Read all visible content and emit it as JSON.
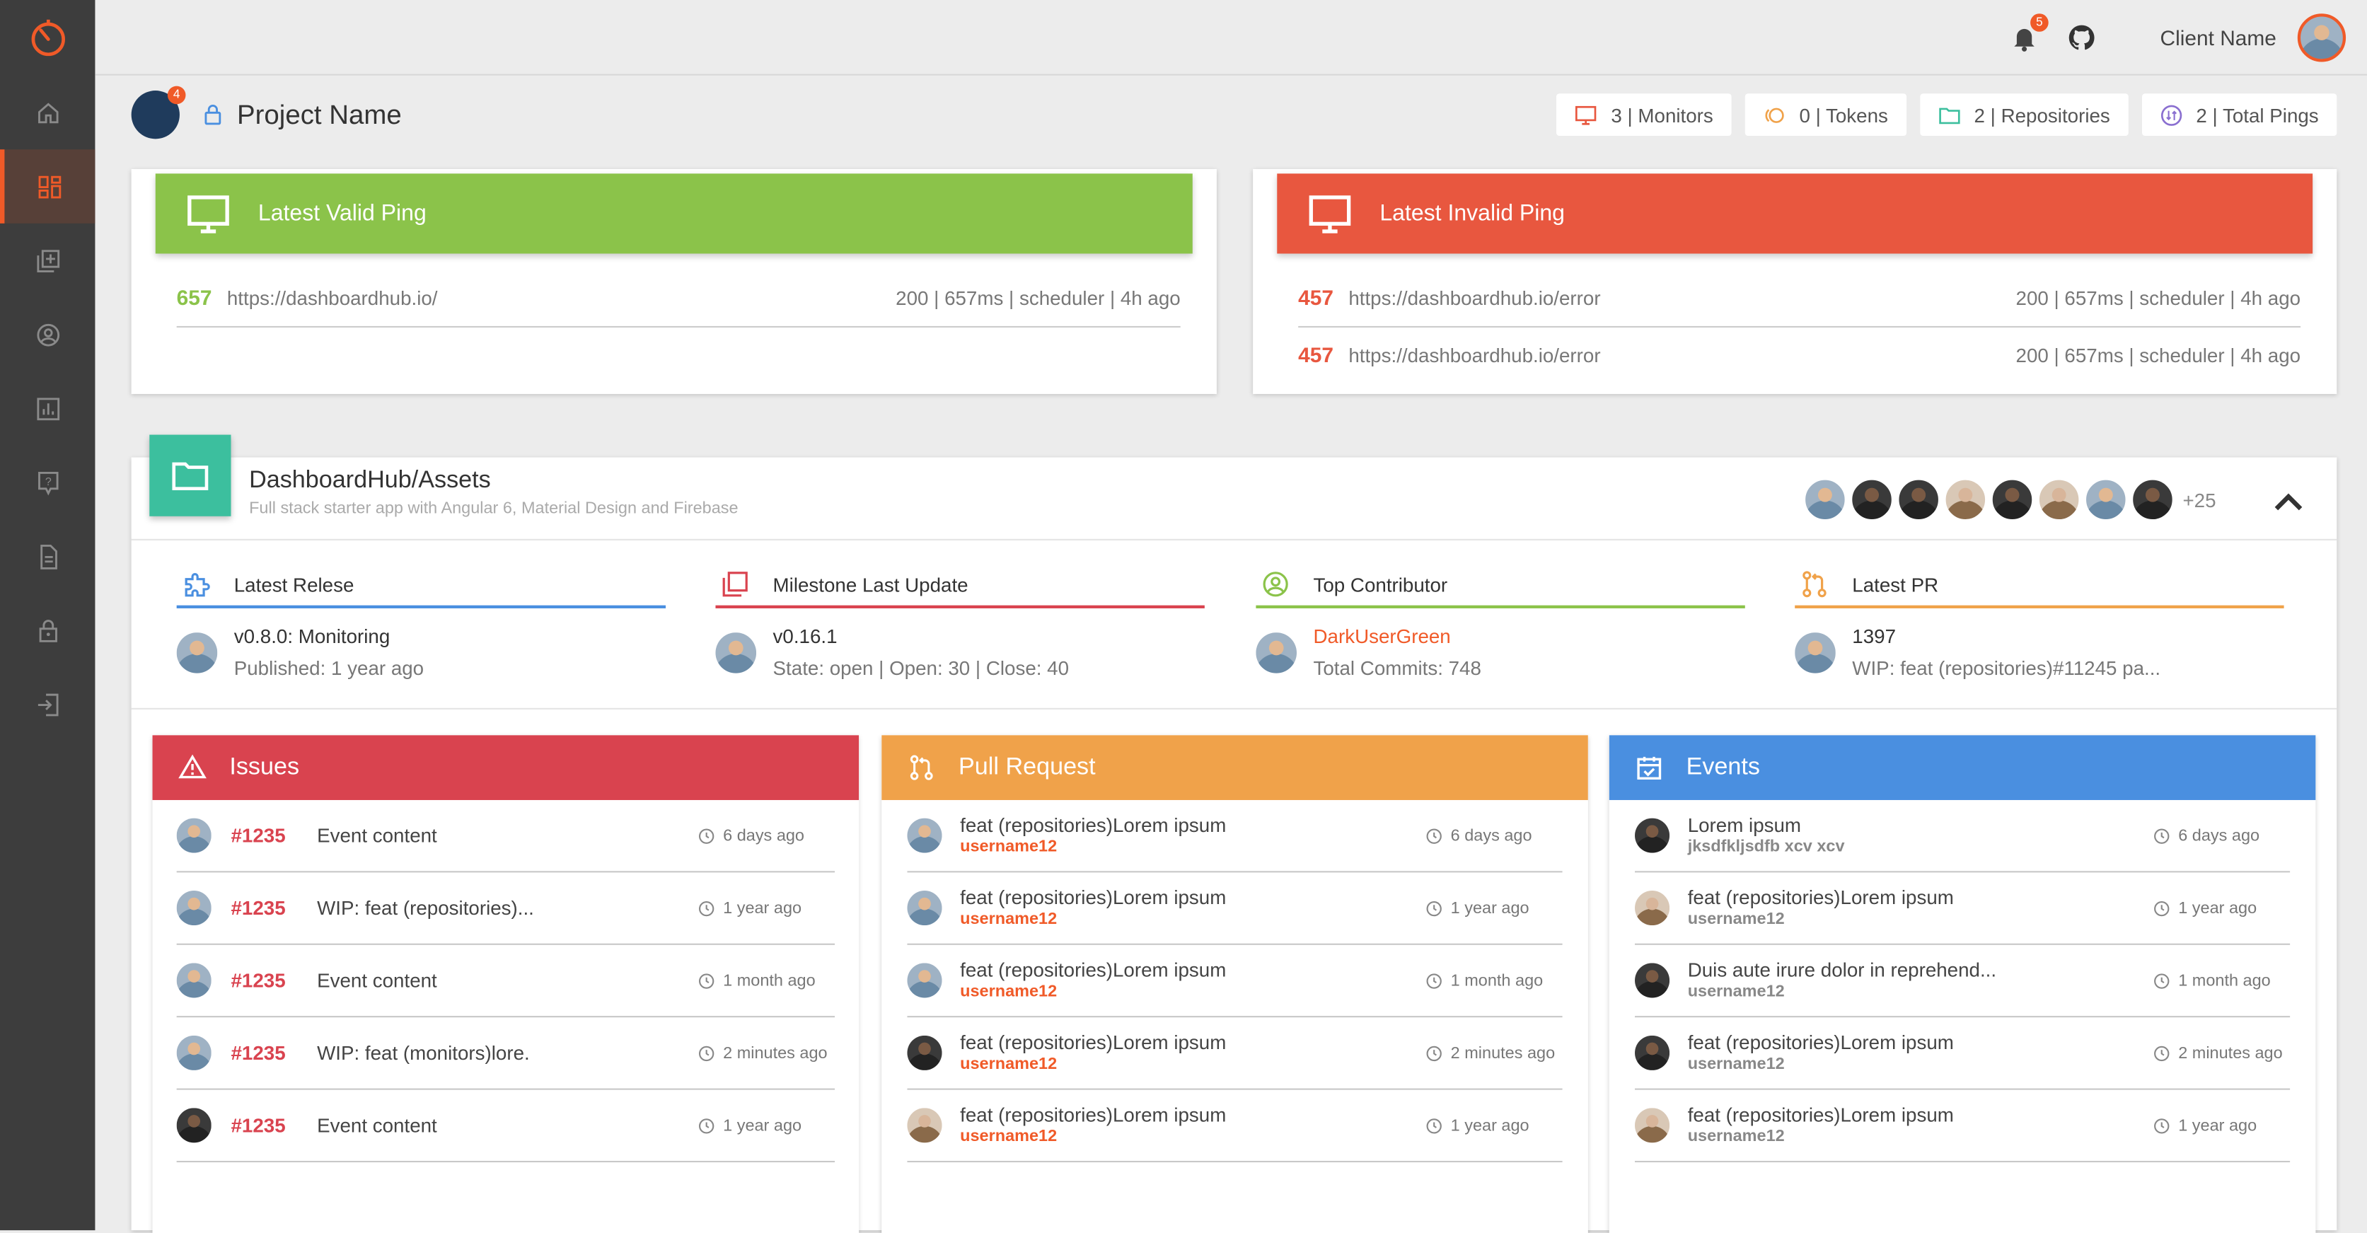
{
  "sidebar": {
    "items": [
      {
        "icon": "home-icon",
        "label": "Home"
      },
      {
        "icon": "dashboard-icon",
        "label": "Dashboard",
        "active": true
      },
      {
        "icon": "library-add-icon",
        "label": "Projects"
      },
      {
        "icon": "account-circle-icon",
        "label": "Account"
      },
      {
        "icon": "insert-chart-icon",
        "label": "Reports"
      },
      {
        "icon": "help-icon",
        "label": "Help"
      },
      {
        "icon": "description-icon",
        "label": "Docs"
      },
      {
        "icon": "lock-icon",
        "label": "Security"
      },
      {
        "icon": "exit-icon",
        "label": "Logout"
      }
    ]
  },
  "header": {
    "notifications_count": "5",
    "client_name": "Client Name"
  },
  "project": {
    "title": "Project Name",
    "badge": "4",
    "stats": {
      "monitors": "3 | Monitors",
      "tokens": "0 | Tokens",
      "repositories": "2 | Repositories",
      "pings": "2 | Total Pings"
    }
  },
  "valid_ping": {
    "title": "Latest Valid Ping",
    "rows": [
      {
        "code": "657",
        "url": "https://dashboardhub.io/",
        "meta": "200 | 657ms | scheduler | 4h ago"
      }
    ]
  },
  "invalid_ping": {
    "title": "Latest Invalid Ping",
    "rows": [
      {
        "code": "457",
        "url": "https://dashboardhub.io/error",
        "meta": "200 | 657ms | scheduler | 4h ago"
      },
      {
        "code": "457",
        "url": "https://dashboardhub.io/error",
        "meta": "200 | 657ms | scheduler | 4h ago"
      }
    ]
  },
  "repo": {
    "title": "DashboardHub/Assets",
    "subtitle": "Full stack starter app with Angular 6, Material Design and Firebase",
    "more_contributors": "+25",
    "release": {
      "label": "Latest Relese",
      "line1": "v0.8.0: Monitoring",
      "line2": "Published: 1 year ago"
    },
    "milestone": {
      "label": "Milestone Last Update",
      "line1": "v0.16.1",
      "line2": "State: open | Open: 30 | Close: 40"
    },
    "contributor": {
      "label": "Top Contributor",
      "line1": "DarkUserGreen",
      "line2": "Total Commits: 748"
    },
    "pr": {
      "label": "Latest PR",
      "line1": "1397",
      "line2": "WIP: feat (repositories)#11245 pa..."
    }
  },
  "issues": {
    "title": "Issues",
    "rows": [
      {
        "num": "#1235",
        "text": "Event content",
        "time": "6 days ago"
      },
      {
        "num": "#1235",
        "text": "WIP: feat (repositories)...",
        "time": "1 year ago"
      },
      {
        "num": "#1235",
        "text": "Event content",
        "time": "1 month ago"
      },
      {
        "num": "#1235",
        "text": "WIP: feat (monitors)lore.",
        "time": "2 minutes ago"
      },
      {
        "num": "#1235",
        "text": "Event content",
        "time": "1 year ago"
      }
    ]
  },
  "pull_requests": {
    "title": "Pull Request",
    "rows": [
      {
        "title": "feat (repositories)Lorem ipsum",
        "user": "username12",
        "time": "6 days ago"
      },
      {
        "title": "feat (repositories)Lorem ipsum",
        "user": "username12",
        "time": "1 year ago"
      },
      {
        "title": "feat (repositories)Lorem ipsum",
        "user": "username12",
        "time": "1 month ago"
      },
      {
        "title": "feat (repositories)Lorem ipsum",
        "user": "username12",
        "time": "2 minutes ago"
      },
      {
        "title": "feat (repositories)Lorem ipsum",
        "user": "username12",
        "time": "1 year ago"
      }
    ]
  },
  "events": {
    "title": "Events",
    "rows": [
      {
        "title": "Lorem ipsum",
        "user": "jksdfkljsdfb xcv xcv",
        "time": "6 days ago"
      },
      {
        "title": "feat (repositories)Lorem ipsum",
        "user": "username12",
        "time": "1 year ago"
      },
      {
        "title": "Duis aute irure dolor in reprehend...",
        "user": "username12",
        "time": "1 month ago"
      },
      {
        "title": "feat (repositories)Lorem ipsum",
        "user": "username12",
        "time": "2 minutes ago"
      },
      {
        "title": "feat (repositories)Lorem ipsum",
        "user": "username12",
        "time": "1 year ago"
      }
    ]
  },
  "colors": {
    "accent": "#f05a28",
    "valid": "#8bc34a",
    "invalid": "#e8573f",
    "issues": "#d9434f",
    "pull_request": "#f0a24a",
    "events": "#4a8fe0",
    "repo": "#3cbf9e"
  }
}
